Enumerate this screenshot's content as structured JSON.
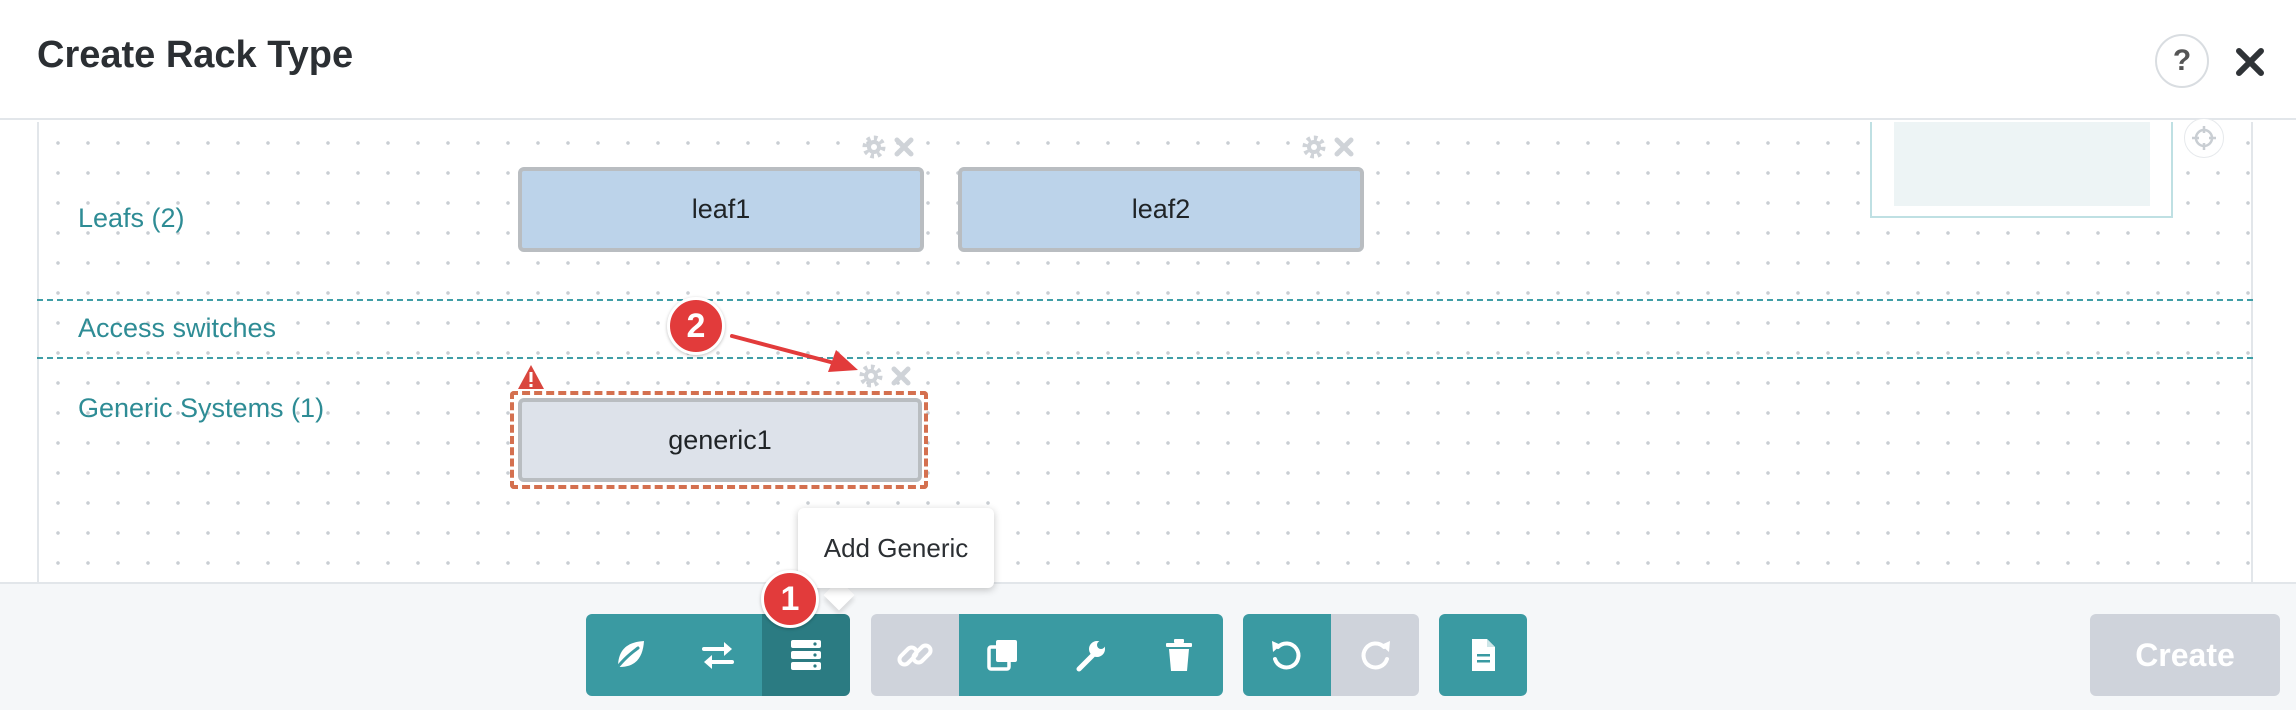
{
  "header": {
    "title": "Create Rack Type",
    "help_label": "?"
  },
  "canvas": {
    "rows": [
      {
        "id": "leafs",
        "label": "Leafs (2)"
      },
      {
        "id": "access",
        "label": "Access switches"
      },
      {
        "id": "generic",
        "label": "Generic Systems (1)"
      }
    ],
    "nodes": [
      {
        "id": "leaf1",
        "label": "leaf1",
        "kind": "leaf"
      },
      {
        "id": "leaf2",
        "label": "leaf2",
        "kind": "leaf"
      },
      {
        "id": "generic1",
        "label": "generic1",
        "kind": "generic",
        "warning": true,
        "selected": true
      }
    ]
  },
  "tooltip": {
    "text": "Add Generic"
  },
  "annotations": {
    "step1": "1",
    "step2": "2"
  },
  "toolbar": {
    "groups": [
      {
        "buttons": [
          {
            "icon": "leaf-icon",
            "state": "normal"
          },
          {
            "icon": "exchange-icon",
            "state": "normal"
          },
          {
            "icon": "server-icon",
            "state": "active"
          }
        ]
      },
      {
        "buttons": [
          {
            "icon": "link-icon",
            "state": "disabled"
          },
          {
            "icon": "copy-icon",
            "state": "normal"
          },
          {
            "icon": "wrench-icon",
            "state": "normal"
          },
          {
            "icon": "trash-icon",
            "state": "normal"
          }
        ]
      },
      {
        "buttons": [
          {
            "icon": "undo-icon",
            "state": "normal"
          },
          {
            "icon": "redo-icon",
            "state": "disabled"
          }
        ]
      },
      {
        "buttons": [
          {
            "icon": "document-icon",
            "state": "normal"
          }
        ]
      }
    ],
    "create_label": "Create"
  },
  "colors": {
    "accent": "#3a9aa2",
    "accent_active": "#2b7b82",
    "disabled": "#cfd3db",
    "leaf_fill": "#bcd3ea",
    "generic_fill": "#dde2ea",
    "row_label": "#2e8c95",
    "warning": "#d4704f",
    "badge": "#e23b3b"
  }
}
